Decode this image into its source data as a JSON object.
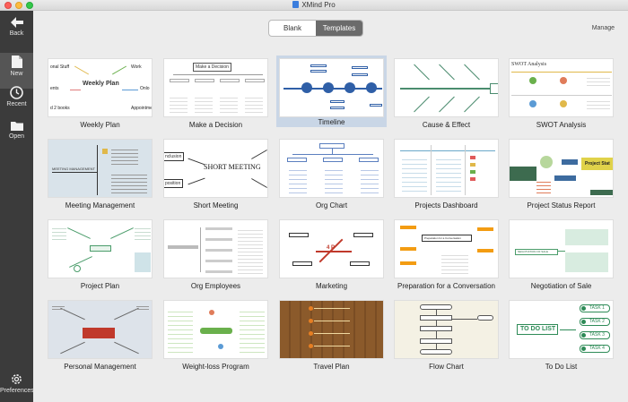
{
  "window": {
    "title": "XMind Pro"
  },
  "sidebar": {
    "back": "Back",
    "new": "New",
    "recent": "Recent",
    "open": "Open",
    "preferences": "Preferences"
  },
  "tabs": {
    "blank": "Blank",
    "templates": "Templates"
  },
  "manage": "Manage",
  "templates": [
    {
      "label": "Weekly Plan",
      "selected": false
    },
    {
      "label": "Make a Decision",
      "selected": false
    },
    {
      "label": "Timeline",
      "selected": true
    },
    {
      "label": "Cause & Effect",
      "selected": false
    },
    {
      "label": "SWOT Analysis",
      "selected": false
    },
    {
      "label": "Meeting Management",
      "selected": false
    },
    {
      "label": "Short Meeting",
      "selected": false
    },
    {
      "label": "Org Chart",
      "selected": false
    },
    {
      "label": "Projects Dashboard",
      "selected": false
    },
    {
      "label": "Project Status Report",
      "selected": false
    },
    {
      "label": "Project Plan",
      "selected": false
    },
    {
      "label": "Org Employees",
      "selected": false
    },
    {
      "label": "Marketing",
      "selected": false
    },
    {
      "label": "Preparation for a Conversation",
      "selected": false
    },
    {
      "label": "Negotiation of Sale",
      "selected": false
    },
    {
      "label": "Personal Management",
      "selected": false
    },
    {
      "label": "Weight-loss Program",
      "selected": false
    },
    {
      "label": "Travel Plan",
      "selected": false
    },
    {
      "label": "Flow Chart",
      "selected": false
    },
    {
      "label": "To Do List",
      "selected": false
    }
  ],
  "thumb_text": {
    "weekly_center": "Weekly Plan",
    "weekly_work": "Work",
    "weekly_personal": "onal Stuff",
    "weekly_ents": "ents",
    "weekly_books": "d 2 books",
    "weekly_onlo": "Onlo",
    "weekly_appoint": "Appointme",
    "decision_title": "Make a Decision",
    "swot_title": "SWOT Analysis",
    "short_meeting": "SHORT MEETING",
    "short_conclusion": "nclusion",
    "short_position": "position",
    "project_status": "Project Stat",
    "todo_title": "TO DO LIST",
    "todo_tasks": [
      "TASK 1",
      "TASK 2",
      "TASK 3",
      "TASK 4"
    ],
    "meeting_mgmt": "MEETING MANAGEMENT",
    "negotiation": "NEGOTIATION OF SALE",
    "preparation": "Preparation for a Conversation",
    "marketing_center": "4 P"
  }
}
